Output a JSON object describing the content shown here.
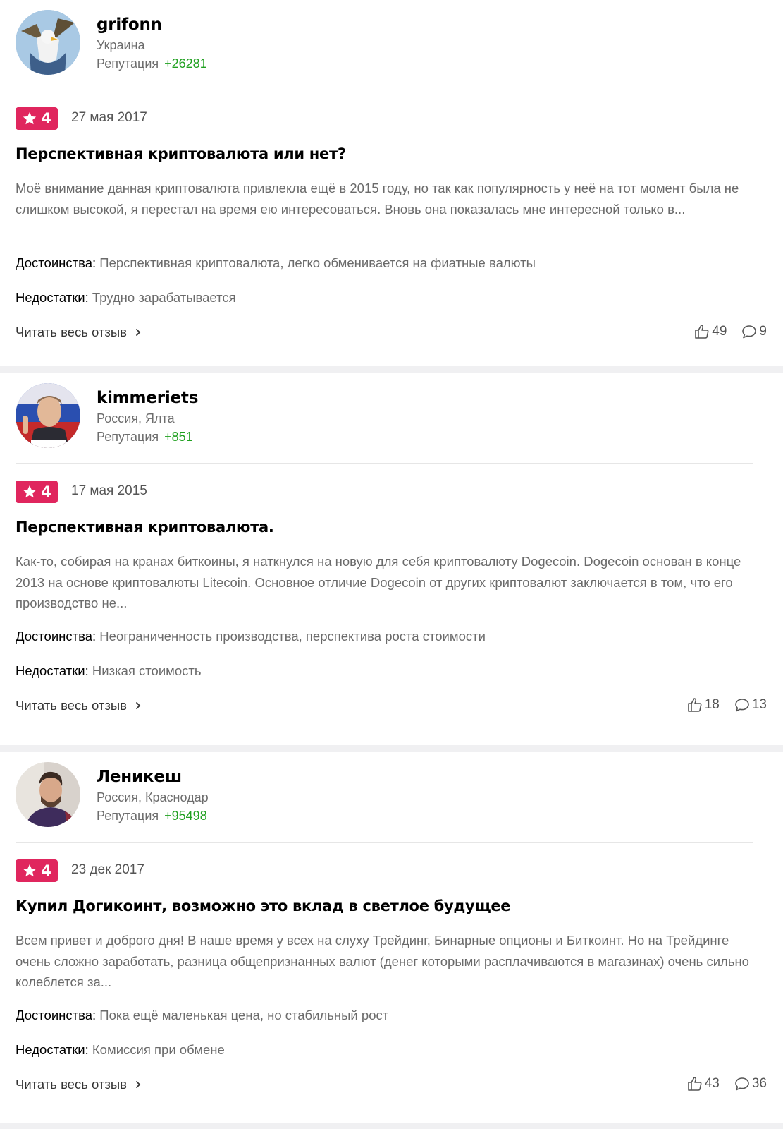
{
  "reviews": [
    {
      "user": {
        "name": "grifonn",
        "location": "Украина",
        "reputation_label": "Репутация",
        "reputation_value": "+26281",
        "avatar": "eagle-avatar"
      },
      "rating": "4",
      "date": "27 мая 2017",
      "title": "Перспективная криптовалюта или нет?",
      "text": "Моё внимание данная криптовалюта привлекла ещё в 2015 году, но так как популярность у неё на тот момент была не слишком высокой, я перестал на время ею интересоваться. Вновь она показалась мне интересной только в...",
      "pros_label": "Достоинства:",
      "pros": "Перспективная криптовалюта, легко обменивается на фиатные валюты",
      "cons_label": "Недостатки:",
      "cons": "Трудно зарабатывается",
      "read_more": "Читать весь отзыв",
      "likes": "49",
      "comments": "9"
    },
    {
      "user": {
        "name": "kimmeriets",
        "location": "Россия, Ялта",
        "reputation_label": "Репутация",
        "reputation_value": "+851",
        "avatar": "man-portrait-avatar"
      },
      "rating": "4",
      "date": "17 мая 2015",
      "title": "Перспективная криптовалюта.",
      "text": "Как-то, собирая на кранах биткоины, я наткнулся на новую для себя криптовалюту Dogecoin. Dogecoin основан в конце 2013 на основе криптовалюты Litecoin. Основное отличие Dogecoin от других криптовалют заключается в том, что его производство не...",
      "pros_label": "Достоинства:",
      "pros": "Неограниченность производства, перспектива роста стоимости",
      "cons_label": "Недостатки:",
      "cons": "Низкая стоимость",
      "read_more": "Читать весь отзыв",
      "likes": "18",
      "comments": "13"
    },
    {
      "user": {
        "name": "Леникеш",
        "location": "Россия, Краснодар",
        "reputation_label": "Репутация",
        "reputation_value": "+95498",
        "avatar": "man-photo-avatar"
      },
      "rating": "4",
      "date": "23 дек 2017",
      "title": "Купил Догикоинт, возможно это вклад в светлое будущее",
      "text": "Всем привет и доброго дня! В наше время у всех на слуху Трейдинг, Бинарные опционы и Биткоинт. Но на Трейдинге очень сложно заработать, разница общепризнанных валют (денег которыми расплачиваются в магазинах) очень сильно колеблется за...",
      "pros_label": "Достоинства:",
      "pros": "Пока ещё маленькая цена, но стабильный рост",
      "cons_label": "Недостатки:",
      "cons": "Комиссия при обмене",
      "read_more": "Читать весь отзыв",
      "likes": "43",
      "comments": "36"
    }
  ],
  "colors": {
    "rating_badge": "#e0265e",
    "reputation": "#20a020",
    "separator": "#f0f0f2"
  }
}
